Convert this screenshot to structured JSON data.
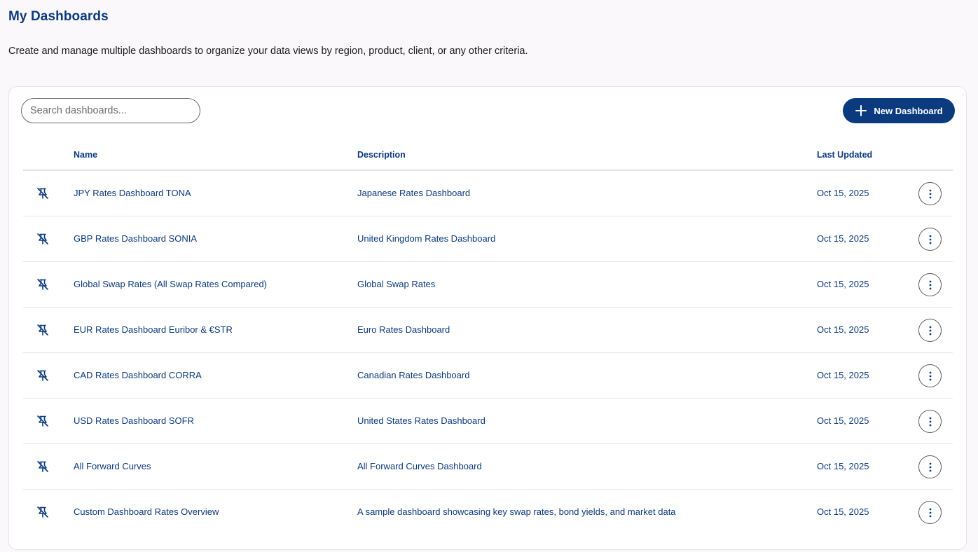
{
  "header": {
    "title": "My Dashboards",
    "subtitle": "Create and manage multiple dashboards to organize your data views by region, product, client, or any other criteria."
  },
  "toolbar": {
    "search_placeholder": "Search dashboards...",
    "search_value": "",
    "new_button_label": "New Dashboard"
  },
  "table": {
    "columns": {
      "pin": "",
      "name": "Name",
      "description": "Description",
      "last_updated": "Last Updated"
    },
    "rows": [
      {
        "name": "JPY Rates Dashboard TONA",
        "description": "Japanese Rates Dashboard",
        "last_updated": "Oct 15, 2025",
        "pinned": false
      },
      {
        "name": "GBP Rates Dashboard SONIA",
        "description": "United Kingdom Rates Dashboard",
        "last_updated": "Oct 15, 2025",
        "pinned": false
      },
      {
        "name": "Global Swap Rates (All Swap Rates Compared)",
        "description": "Global Swap Rates",
        "last_updated": "Oct 15, 2025",
        "pinned": false
      },
      {
        "name": "EUR Rates Dashboard Euribor & €STR",
        "description": "Euro Rates Dashboard",
        "last_updated": "Oct 15, 2025",
        "pinned": false
      },
      {
        "name": "CAD Rates Dashboard CORRA",
        "description": "Canadian Rates Dashboard",
        "last_updated": "Oct 15, 2025",
        "pinned": false
      },
      {
        "name": "USD Rates Dashboard SOFR",
        "description": "United States Rates Dashboard",
        "last_updated": "Oct 15, 2025",
        "pinned": false
      },
      {
        "name": "All Forward Curves",
        "description": "All Forward Curves Dashboard",
        "last_updated": "Oct 15, 2025",
        "pinned": false
      },
      {
        "name": "Custom Dashboard Rates Overview",
        "description": "A sample dashboard showcasing key swap rates, bond yields, and market data",
        "last_updated": "Oct 15, 2025",
        "pinned": false
      }
    ],
    "row_icons": {
      "pin": "pin-off-icon",
      "actions": "more-vertical-icon"
    }
  },
  "colors": {
    "brand": "#0b3a7e",
    "background": "#faf8fb",
    "card": "#ffffff",
    "border": "#e4e4ea"
  }
}
